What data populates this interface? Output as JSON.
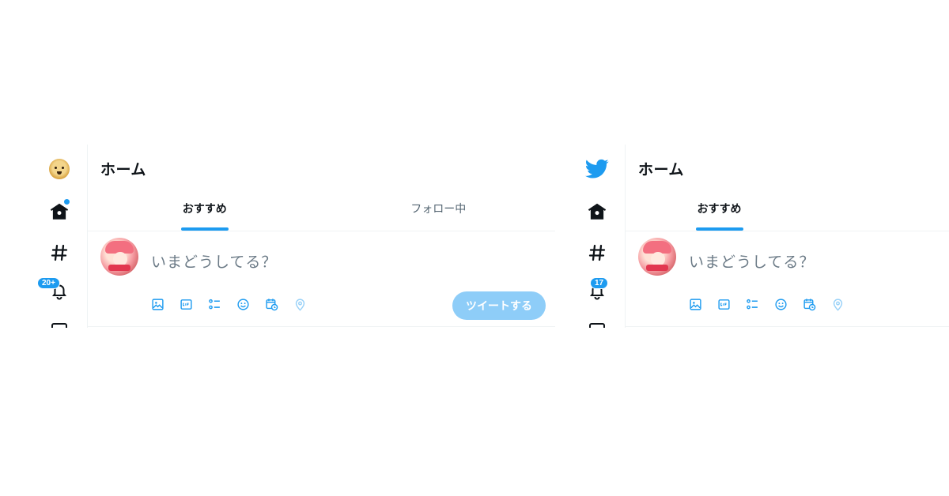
{
  "left": {
    "header": {
      "title": "ホーム"
    },
    "tabs": [
      {
        "label": "おすすめ",
        "active": true
      },
      {
        "label": "フォロー中",
        "active": false
      }
    ],
    "composer": {
      "placeholder": "いまどうしてる？",
      "submit_label": "ツイートする"
    },
    "notifications": {
      "badge": "20+"
    },
    "rail_icons": [
      "doge-avatar-icon",
      "home-icon",
      "hashtag-icon",
      "bell-icon",
      "mail-icon"
    ]
  },
  "right": {
    "header": {
      "title": "ホーム"
    },
    "tabs": [
      {
        "label": "おすすめ",
        "active": true
      }
    ],
    "composer": {
      "placeholder": "いまどうしてる？"
    },
    "notifications": {
      "badge": "17"
    },
    "rail_icons": [
      "twitter-bird-icon",
      "home-icon",
      "hashtag-icon",
      "bell-icon",
      "mail-icon"
    ]
  },
  "composer_tools": [
    "image-icon",
    "gif-icon",
    "poll-icon",
    "emoji-icon",
    "schedule-icon",
    "location-icon"
  ],
  "colors": {
    "accent": "#1d9bf0",
    "button_disabled": "#8ecdf8",
    "border": "#eff3f4",
    "text_secondary": "#536471"
  }
}
